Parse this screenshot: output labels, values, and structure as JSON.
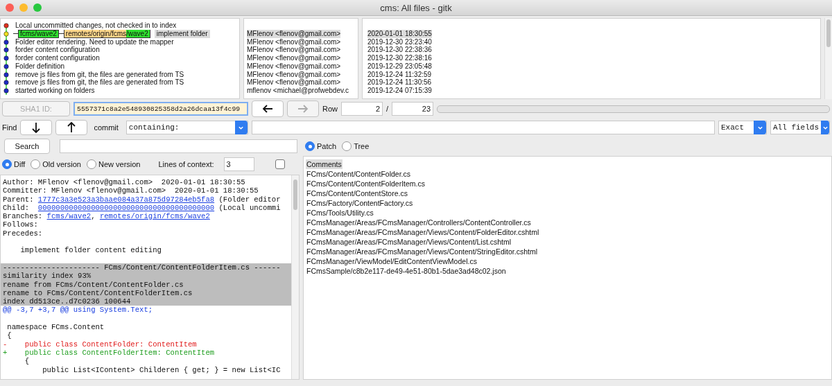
{
  "window": {
    "title": "cms: All files - gitk"
  },
  "commits": [
    {
      "headline": "Local uncommitted changes, not checked in to index",
      "color": "#e0301e",
      "selected": false
    },
    {
      "headline": "implement folder",
      "color": "#f0e020",
      "selected": true,
      "refs": [
        {
          "kind": "local",
          "name": "fcms/wave2"
        },
        {
          "kind": "remote",
          "prefix": "remotes/origin/fcms",
          "name": "/wave2"
        }
      ],
      "author": "MFlenov <flenov@gmail.com>",
      "date": "2020-01-01 18:30:55"
    },
    {
      "headline": "Folder editor rendering. Need to update the mapper",
      "color": "#1c2bc4",
      "selected": false,
      "author": "MFlenov <flenov@gmail.com>",
      "date": "2019-12-30 23:23:40"
    },
    {
      "headline": "forder content configuration",
      "color": "#1c2bc4",
      "selected": false,
      "author": "MFlenov <flenov@gmail.com>",
      "date": "2019-12-30 22:38:36"
    },
    {
      "headline": "forder content configuration",
      "color": "#1c2bc4",
      "selected": false,
      "author": "MFlenov <flenov@gmail.com>",
      "date": "2019-12-30 22:38:16"
    },
    {
      "headline": "Folder definition",
      "color": "#1c2bc4",
      "selected": false,
      "author": "MFlenov <flenov@gmail.com>",
      "date": "2019-12-29 23:05:48"
    },
    {
      "headline": "remove js files from git, the files are generated from TS",
      "color": "#1c2bc4",
      "selected": false,
      "author": "MFlenov <flenov@gmail.com>",
      "date": "2019-12-24 11:32:59"
    },
    {
      "headline": "remove js files from git, the files are generated from TS",
      "color": "#1c2bc4",
      "selected": false,
      "author": "MFlenov <flenov@gmail.com>",
      "date": "2019-12-24 11:30:56"
    },
    {
      "headline": "started working on folders",
      "color": "#1c2bc4",
      "selected": false,
      "author": "mflenov <michael@profwebdev.c",
      "date": "2019-12-24 07:15:39"
    }
  ],
  "sha_bar": {
    "button": {
      "label": "SHA1 ID:",
      "disabled": true
    },
    "value": "5557371c8a2e548930825358d2a26dcaa13f4c99",
    "back": {
      "disabled": false
    },
    "forward": {
      "disabled": true
    },
    "row_label": "Row",
    "row": "2",
    "separator": "/",
    "total": "23"
  },
  "find_bar": {
    "label": "Find",
    "field_label": "commit",
    "type": "containing:",
    "match": "Exact",
    "scope": "All fields"
  },
  "search": {
    "button": "Search"
  },
  "view_mode": [
    {
      "label": "Patch",
      "selected": true
    },
    {
      "label": "Tree",
      "selected": false
    }
  ],
  "diff_options": {
    "modes": [
      {
        "label": "Diff",
        "selected": true
      },
      {
        "label": "Old version",
        "selected": false
      },
      {
        "label": "New version",
        "selected": false
      }
    ],
    "context_label": "Lines of context:",
    "context": "3",
    "checkbox": {
      "checked": false
    }
  },
  "diff_lines": [
    {
      "kind": "meta",
      "text": "Author: MFlenov <flenov@gmail.com>  2020-01-01 18:30:55"
    },
    {
      "kind": "meta",
      "text": "Committer: MFlenov <flenov@gmail.com>  2020-01-01 18:30:55"
    },
    {
      "kind": "meta",
      "segments": [
        {
          "text": "Parent: "
        },
        {
          "text": "1777c3a3e523a3baae084a37a875d97284eb5fa8",
          "link": true
        },
        {
          "text": " (Folder editor"
        }
      ]
    },
    {
      "kind": "meta",
      "segments": [
        {
          "text": "Child:  "
        },
        {
          "text": "0000000000000000000000000000000000000000",
          "link": true
        },
        {
          "text": " (Local uncommi"
        }
      ]
    },
    {
      "kind": "meta",
      "segments": [
        {
          "text": "Branches: "
        },
        {
          "text": "fcms/wave2",
          "link": true
        },
        {
          "text": ", "
        },
        {
          "text": "remotes/origin/fcms/wave2",
          "link": true
        }
      ]
    },
    {
      "kind": "meta",
      "text": "Follows:"
    },
    {
      "kind": "meta",
      "text": "Precedes:"
    },
    {
      "kind": "blank"
    },
    {
      "kind": "message",
      "text": "    implement folder content editing"
    },
    {
      "kind": "blank"
    },
    {
      "kind": "header",
      "text": "---------------------- FCms/Content/ContentFolderItem.cs ------"
    },
    {
      "kind": "header",
      "text": "similarity index 93%"
    },
    {
      "kind": "header",
      "text": "rename from FCms/Content/ContentFolder.cs"
    },
    {
      "kind": "header",
      "text": "rename to FCms/Content/ContentFolderItem.cs"
    },
    {
      "kind": "header",
      "text": "index dd513ce..d7c0236 100644"
    },
    {
      "kind": "hunk",
      "text": "@@ -3,7 +3,7 @@ using System.Text;"
    },
    {
      "kind": "blank"
    },
    {
      "kind": "context",
      "text": " namespace FCms.Content"
    },
    {
      "kind": "context",
      "text": " {"
    },
    {
      "kind": "removed",
      "text": "-    public class ContentFolder: ContentItem"
    },
    {
      "kind": "added",
      "text": "+    public class ContentFolderItem: ContentItem"
    },
    {
      "kind": "context",
      "text": "     {"
    },
    {
      "kind": "context",
      "text": "         public List<IContent> Childeren { get; } = new List<IC"
    }
  ],
  "files": [
    {
      "path": "Comments",
      "selected": true
    },
    {
      "path": "FCms/Content/ContentFolder.cs",
      "selected": false
    },
    {
      "path": "FCms/Content/ContentFolderItem.cs",
      "selected": false
    },
    {
      "path": "FCms/Content/ContentStore.cs",
      "selected": false
    },
    {
      "path": "FCms/Factory/ContentFactory.cs",
      "selected": false
    },
    {
      "path": "FCms/Tools/Utility.cs",
      "selected": false
    },
    {
      "path": "FCmsManager/Areas/FCmsManager/Controllers/ContentController.cs",
      "selected": false
    },
    {
      "path": "FCmsManager/Areas/FCmsManager/Views/Content/FolderEditor.cshtml",
      "selected": false
    },
    {
      "path": "FCmsManager/Areas/FCmsManager/Views/Content/List.cshtml",
      "selected": false
    },
    {
      "path": "FCmsManager/Areas/FCmsManager/Views/Content/StringEditor.cshtml",
      "selected": false
    },
    {
      "path": "FCmsManager/ViewModel/EditContentViewModel.cs",
      "selected": false
    },
    {
      "path": "FCmsSample/c8b2e117-de49-4e51-80b1-5dae3ad48c02.json",
      "selected": false
    }
  ]
}
